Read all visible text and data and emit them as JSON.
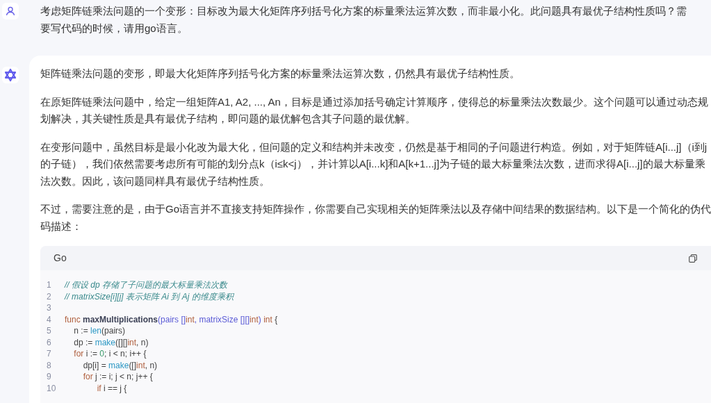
{
  "user_message": {
    "text": "考虑矩阵链乘法问题的一个变形：目标改为最大化矩阵序列括号化方案的标量乘法运算次数，而非最小化。此问题具有最优子结构性质吗？需要写代码的时候，请用go语言。"
  },
  "assistant_message": {
    "paragraphs": [
      "矩阵链乘法问题的变形，即最大化矩阵序列括号化方案的标量乘法运算次数，仍然具有最优子结构性质。",
      "在原矩阵链乘法问题中，给定一组矩阵A1, A2, ..., An，目标是通过添加括号确定计算顺序，使得总的标量乘法次数最少。这个问题可以通过动态规划解决，其关键性质是具有最优子结构，即问题的最优解包含其子问题的最优解。",
      "在变形问题中，虽然目标是最小化改为最大化，但问题的定义和结构并未改变，仍然是基于相同的子问题进行构造。例如，对于矩阵链A[i...j]（i到j的子链），我们依然需要考虑所有可能的划分点k（i≤k<j），并计算以A[i...k]和A[k+1...j]为子链的最大标量乘法次数，进而求得A[i...j]的最大标量乘法次数。因此，该问题同样具有最优子结构性质。",
      "不过，需要注意的是，由于Go语言并不直接支持矩阵操作，你需要自己实现相关的矩阵乘法以及存储中间结果的数据结构。以下是一个简化的伪代码描述："
    ],
    "code_block": {
      "language": "Go",
      "lines": [
        {
          "number": "1",
          "tokens": [
            {
              "kind": "comment",
              "text": "// 假设 dp 存储了子问题的最大标量乘法次数"
            }
          ]
        },
        {
          "number": "2",
          "tokens": [
            {
              "kind": "comment",
              "text": "// matrixSize[i][j] 表示矩阵 Ai 到 Aj 的维度乘积"
            }
          ]
        },
        {
          "number": "3"
        },
        {
          "number": "4",
          "tokens": [
            {
              "kind": "keyword",
              "text": "func "
            },
            {
              "kind": "function",
              "text": "maxMultiplications"
            },
            {
              "kind": "param",
              "text": "(pairs []"
            },
            {
              "kind": "type",
              "text": "int"
            },
            {
              "kind": "param",
              "text": ", matrixSize [][]"
            },
            {
              "kind": "type",
              "text": "int"
            },
            {
              "kind": "param",
              "text": ")"
            },
            {
              "kind": "type",
              "text": " int"
            },
            {
              "kind": "plain",
              "text": " {"
            }
          ]
        },
        {
          "number": "5",
          "tokens": [
            {
              "kind": "plain",
              "text": "    n := "
            },
            {
              "kind": "builtin",
              "text": "len"
            },
            {
              "kind": "plain",
              "text": "(pairs)"
            }
          ]
        },
        {
          "number": "6",
          "tokens": [
            {
              "kind": "plain",
              "text": "    dp := "
            },
            {
              "kind": "builtin",
              "text": "make"
            },
            {
              "kind": "plain",
              "text": "([][]"
            },
            {
              "kind": "type",
              "text": "int"
            },
            {
              "kind": "plain",
              "text": ", n)"
            }
          ]
        },
        {
          "number": "7",
          "tokens": [
            {
              "kind": "keyword",
              "text": "    for"
            },
            {
              "kind": "plain",
              "text": " i := "
            },
            {
              "kind": "number",
              "text": "0"
            },
            {
              "kind": "plain",
              "text": "; i < n; i++ {"
            }
          ]
        },
        {
          "number": "8",
          "tokens": [
            {
              "kind": "plain",
              "text": "        dp[i] = "
            },
            {
              "kind": "builtin",
              "text": "make"
            },
            {
              "kind": "plain",
              "text": "([]"
            },
            {
              "kind": "type",
              "text": "int"
            },
            {
              "kind": "plain",
              "text": ", n)"
            }
          ]
        },
        {
          "number": "9",
          "tokens": [
            {
              "kind": "keyword",
              "text": "        for"
            },
            {
              "kind": "plain",
              "text": " j := i; j < n; j++ {"
            }
          ]
        },
        {
          "number": "10",
          "tokens": [
            {
              "kind": "keyword",
              "text": "              if"
            },
            {
              "kind": "plain",
              "text": " i == j {"
            }
          ]
        }
      ]
    }
  }
}
